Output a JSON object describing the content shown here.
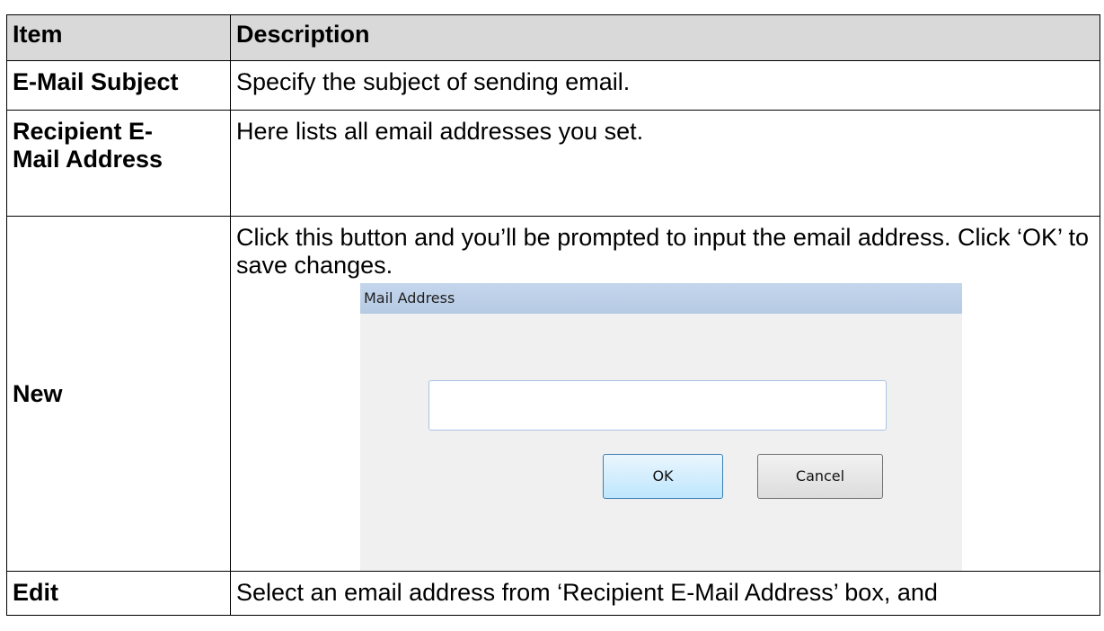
{
  "table": {
    "headers": {
      "item": "Item",
      "description": "Description"
    },
    "rows": [
      {
        "item": "E-Mail Subject",
        "description": "Specify the subject of sending email."
      },
      {
        "item": "Recipient E-Mail Address",
        "description": "Here lists all email addresses you set."
      },
      {
        "item": "New",
        "description": "Click this button and you’ll be prompted to input the email address. Click ‘OK’ to save changes."
      },
      {
        "item": "Edit",
        "description": "Select an email address from ‘Recipient E-Mail Address’ box, and"
      }
    ]
  },
  "dialog": {
    "title": "Mail Address",
    "input_value": "",
    "ok_label": "OK",
    "cancel_label": "Cancel"
  }
}
